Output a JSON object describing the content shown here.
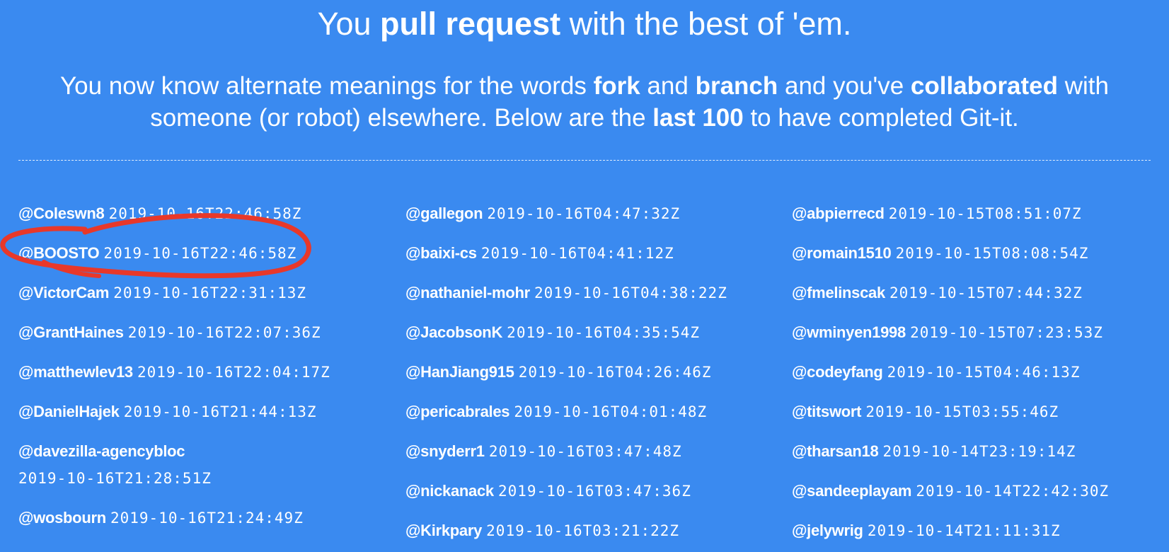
{
  "headline": {
    "pre": "You ",
    "bold": "pull request",
    "post": " with the best of 'em."
  },
  "lead": {
    "p1": "You now know alternate meanings for the words ",
    "b1": "fork",
    "p2": " and ",
    "b2": "branch",
    "p3": " and you've ",
    "b3": "collaborated",
    "p4": " with someone (or robot) elsewhere. Below are the ",
    "b4": "last 100",
    "p5": " to have completed Git-it."
  },
  "columns": [
    [
      {
        "user": "@Coleswn8",
        "time": "2019-10-16T22:46:58Z"
      },
      {
        "user": "@BOOSTO",
        "time": "2019-10-16T22:46:58Z"
      },
      {
        "user": "@VictorCam",
        "time": "2019-10-16T22:31:13Z"
      },
      {
        "user": "@GrantHaines",
        "time": "2019-10-16T22:07:36Z"
      },
      {
        "user": "@matthewlev13",
        "time": "2019-10-16T22:04:17Z"
      },
      {
        "user": "@DanielHajek",
        "time": "2019-10-16T21:44:13Z"
      },
      {
        "user": "@davezilla-agencybloc",
        "time": "2019-10-16T21:28:51Z"
      },
      {
        "user": "@wosbourn",
        "time": "2019-10-16T21:24:49Z"
      }
    ],
    [
      {
        "user": "@gallegon",
        "time": "2019-10-16T04:47:32Z"
      },
      {
        "user": "@baixi-cs",
        "time": "2019-10-16T04:41:12Z"
      },
      {
        "user": "@nathaniel-mohr",
        "time": "2019-10-16T04:38:22Z"
      },
      {
        "user": "@JacobsonK",
        "time": "2019-10-16T04:35:54Z"
      },
      {
        "user": "@HanJiang915",
        "time": "2019-10-16T04:26:46Z"
      },
      {
        "user": "@pericabrales",
        "time": "2019-10-16T04:01:48Z"
      },
      {
        "user": "@snyderr1",
        "time": "2019-10-16T03:47:48Z"
      },
      {
        "user": "@nickanack",
        "time": "2019-10-16T03:47:36Z"
      },
      {
        "user": "@Kirkpary",
        "time": "2019-10-16T03:21:22Z"
      }
    ],
    [
      {
        "user": "@abpierrecd",
        "time": "2019-10-15T08:51:07Z"
      },
      {
        "user": "@romain1510",
        "time": "2019-10-15T08:08:54Z"
      },
      {
        "user": "@fmelinscak",
        "time": "2019-10-15T07:44:32Z"
      },
      {
        "user": "@wminyen1998",
        "time": "2019-10-15T07:23:53Z"
      },
      {
        "user": "@codeyfang",
        "time": "2019-10-15T04:46:13Z"
      },
      {
        "user": "@titswort",
        "time": "2019-10-15T03:55:46Z"
      },
      {
        "user": "@tharsan18",
        "time": "2019-10-14T23:19:14Z"
      },
      {
        "user": "@sandeeplayam",
        "time": "2019-10-14T22:42:30Z"
      },
      {
        "user": "@jelywrig",
        "time": "2019-10-14T21:11:31Z"
      }
    ]
  ],
  "colors": {
    "background": "#3a8af0",
    "text": "#ffffff",
    "annotation": "#e8382a"
  }
}
